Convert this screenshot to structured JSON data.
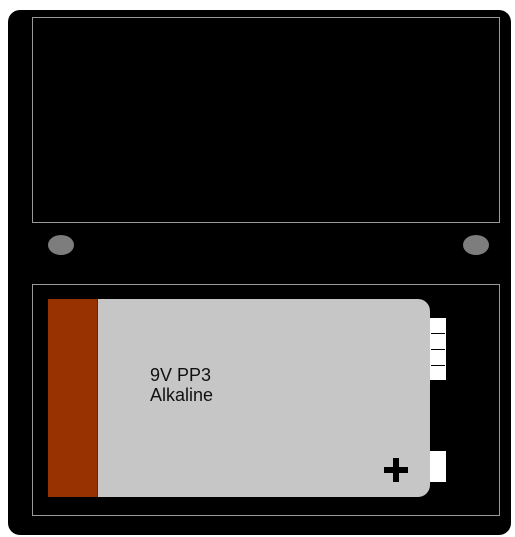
{
  "battery": {
    "line1": "9V PP3",
    "line2": "Alkaline",
    "plus_symbol": "+"
  },
  "colors": {
    "housing": "#000000",
    "panel_border": "#9a9a9a",
    "battery_body": "#c6c6c6",
    "battery_band": "#983200",
    "screw": "#7d7d7d",
    "terminal": "#ffffff"
  },
  "icons": {
    "plus": "plus-icon",
    "screw": "screw-icon"
  }
}
